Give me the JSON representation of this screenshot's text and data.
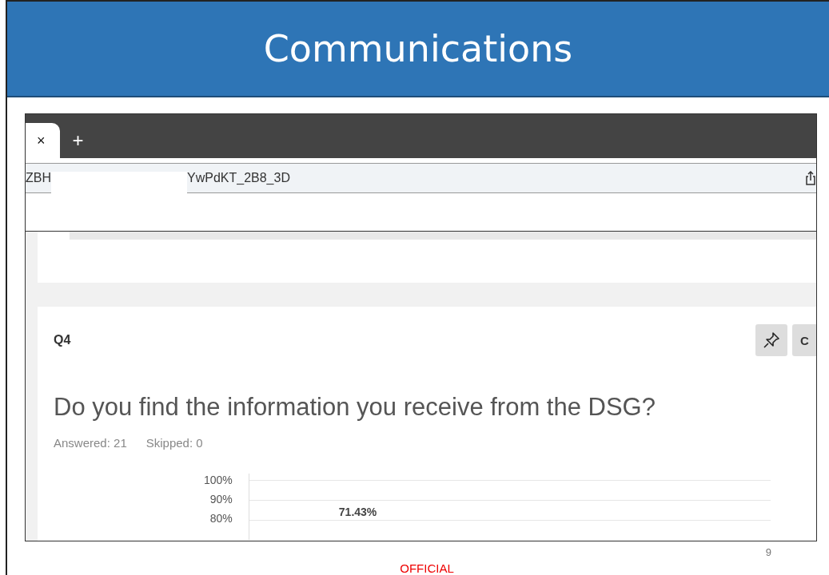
{
  "slide": {
    "title": "Communications",
    "page_number": "9",
    "classification": "OFFICIAL"
  },
  "browser": {
    "tabs": [
      {
        "close": "×",
        "selected": true
      }
    ],
    "new_tab": "+",
    "url_start": "ZBH",
    "url_end": "YwPdKT_2B8_3D"
  },
  "question": {
    "number": "Q4",
    "side_button": "C",
    "text": "Do you find the information you receive from the DSG?",
    "answered": "Answered: 21",
    "skipped": "Skipped: 0",
    "chart": {
      "y_labels": [
        "100%",
        "90%",
        "80%"
      ],
      "bar_label": "71.43%"
    }
  }
}
